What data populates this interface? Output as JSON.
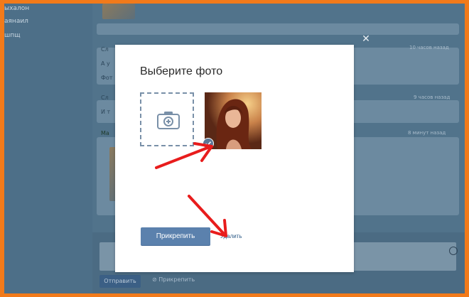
{
  "sidebar": {
    "items": [
      {
        "label": "ыхалон"
      },
      {
        "label": "аянаил"
      },
      {
        "label": "шпщ"
      }
    ]
  },
  "feed": {
    "times": [
      "10 часов назад",
      "9 часов назад",
      "8 минут назад"
    ],
    "snippets": [
      "Сл",
      "А у",
      "Фот",
      "Сл",
      "И т",
      "Ма"
    ]
  },
  "composer": {
    "send_label": "Отправить",
    "attach_label": "Прикрепить"
  },
  "modal": {
    "title": "Выберите фото",
    "attach_button": "Прикрепить",
    "delete_link": "Удалить"
  },
  "colors": {
    "frame_border": "#f27a1a",
    "primary_button": "#5b81ad",
    "link": "#2a5885",
    "arrow": "#e81c1c"
  }
}
